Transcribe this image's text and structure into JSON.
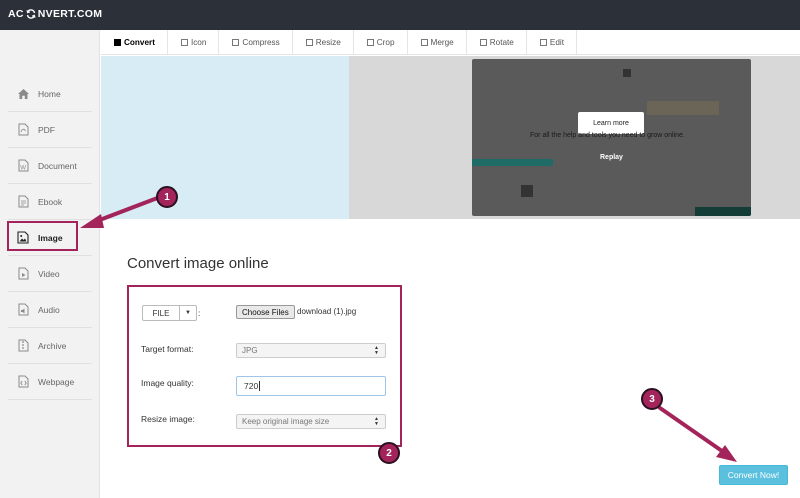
{
  "app": {
    "logo_left": "AC",
    "logo_right": "NVERT.COM"
  },
  "sidebar": {
    "items": [
      {
        "label": "Home",
        "icon": "home-icon"
      },
      {
        "label": "PDF",
        "icon": "pdf-icon"
      },
      {
        "label": "Document",
        "icon": "document-icon"
      },
      {
        "label": "Ebook",
        "icon": "ebook-icon"
      },
      {
        "label": "Image",
        "icon": "image-icon",
        "active": true
      },
      {
        "label": "Video",
        "icon": "video-icon"
      },
      {
        "label": "Audio",
        "icon": "audio-icon"
      },
      {
        "label": "Archive",
        "icon": "archive-icon"
      },
      {
        "label": "Webpage",
        "icon": "webpage-icon"
      }
    ]
  },
  "tabs": [
    "Convert",
    "Icon",
    "Compress",
    "Resize",
    "Crop",
    "Merge",
    "Rotate",
    "Edit"
  ],
  "ad": {
    "learn_more": "Learn more",
    "tagline": "For all the help and tools you need to grow online.",
    "replay": "Replay"
  },
  "main": {
    "title": "Convert image online",
    "file_button": "FILE",
    "choose_files": "Choose Files",
    "file_name": "download (1).jpg",
    "target_format_label": "Target format:",
    "target_format_value": "JPG",
    "image_quality_label": "Image quality:",
    "image_quality_value": "720",
    "resize_label": "Resize image:",
    "resize_value": "Keep original image size",
    "convert_button": "Convert Now!"
  },
  "annotations": {
    "step1": "1",
    "step2": "2",
    "step3": "3"
  },
  "colors": {
    "topbar": "#2c3039",
    "annotation": "#a3245a",
    "convert_button": "#5bc0de"
  }
}
